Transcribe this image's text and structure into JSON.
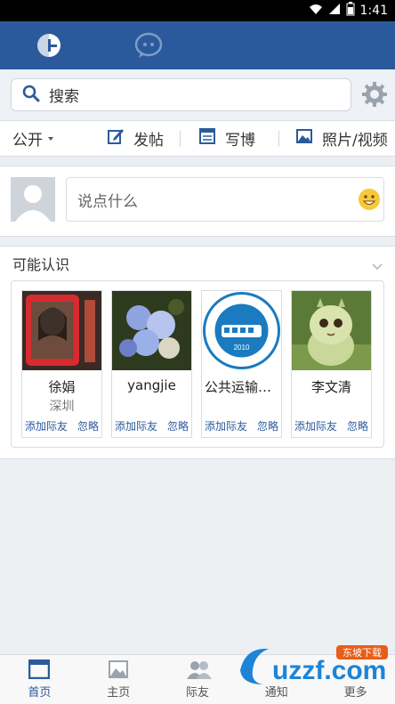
{
  "status": {
    "time": "1:41"
  },
  "search": {
    "placeholder": "搜索"
  },
  "actions": {
    "visibility": "公开",
    "post": "发帖",
    "blog": "写博",
    "photo": "照片/视频"
  },
  "composer": {
    "placeholder": "说点什么"
  },
  "people": {
    "title": "可能认识",
    "add_label": "添加际友",
    "ignore_label": "忽略",
    "items": [
      {
        "name": "徐娟",
        "location": "深圳"
      },
      {
        "name": "yangjie",
        "location": ""
      },
      {
        "name": "公共运输职...",
        "location": "",
        "seal_year": "2010"
      },
      {
        "name": "李文清",
        "location": ""
      }
    ]
  },
  "tabs": [
    {
      "label": "首页"
    },
    {
      "label": "主页"
    },
    {
      "label": "际友"
    },
    {
      "label": "通知"
    },
    {
      "label": "更多"
    }
  ],
  "watermark": {
    "text": "uzzf.com",
    "tag": "东坡下载"
  },
  "colors": {
    "primary": "#2b5a9c",
    "background": "#ecf0f3"
  }
}
